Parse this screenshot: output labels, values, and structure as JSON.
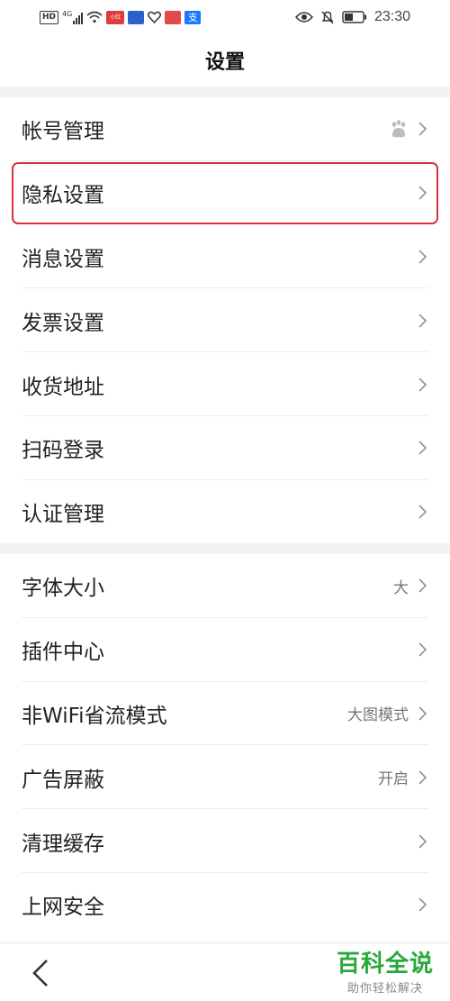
{
  "status_bar": {
    "hd": "HD",
    "network": "4G",
    "time": "23:30",
    "apps": [
      {
        "icon": "xiaohongshu-app-icon",
        "text": "小红书",
        "color": "#e23b3b"
      },
      {
        "icon": "blue-app-icon",
        "text": "",
        "color": "#2a62c9"
      },
      {
        "icon": "heart-outline-icon",
        "text": "",
        "color": "#333333"
      },
      {
        "icon": "red-app-icon",
        "text": "",
        "color": "#e24a4a"
      },
      {
        "icon": "alipay-app-icon",
        "text": "支",
        "color": "#1677ff"
      }
    ]
  },
  "header": {
    "title": "设置"
  },
  "group1": [
    {
      "name": "account",
      "label": "帐号管理",
      "value": "",
      "icon": "baidu-paw-icon"
    },
    {
      "name": "privacy",
      "label": "隐私设置",
      "value": "",
      "highlighted": true
    },
    {
      "name": "message",
      "label": "消息设置",
      "value": ""
    },
    {
      "name": "invoice",
      "label": "发票设置",
      "value": ""
    },
    {
      "name": "address",
      "label": "收货地址",
      "value": ""
    },
    {
      "name": "scan-login",
      "label": "扫码登录",
      "value": ""
    },
    {
      "name": "certification",
      "label": "认证管理",
      "value": ""
    }
  ],
  "group2": [
    {
      "name": "font-size",
      "label": "字体大小",
      "value": "大"
    },
    {
      "name": "plugins",
      "label": "插件中心",
      "value": ""
    },
    {
      "name": "data-saver",
      "label": "非WiFi省流模式",
      "value": "大图模式"
    },
    {
      "name": "ad-block",
      "label": "广告屏蔽",
      "value": "开启"
    },
    {
      "name": "clear-cache",
      "label": "清理缓存",
      "value": ""
    },
    {
      "name": "web-security",
      "label": "上网安全",
      "value": ""
    }
  ],
  "watermark": {
    "main": "百科全说",
    "sub": "助你轻松解决"
  },
  "colors": {
    "highlight": "#d6313a",
    "watermark": "#2aa83a"
  }
}
